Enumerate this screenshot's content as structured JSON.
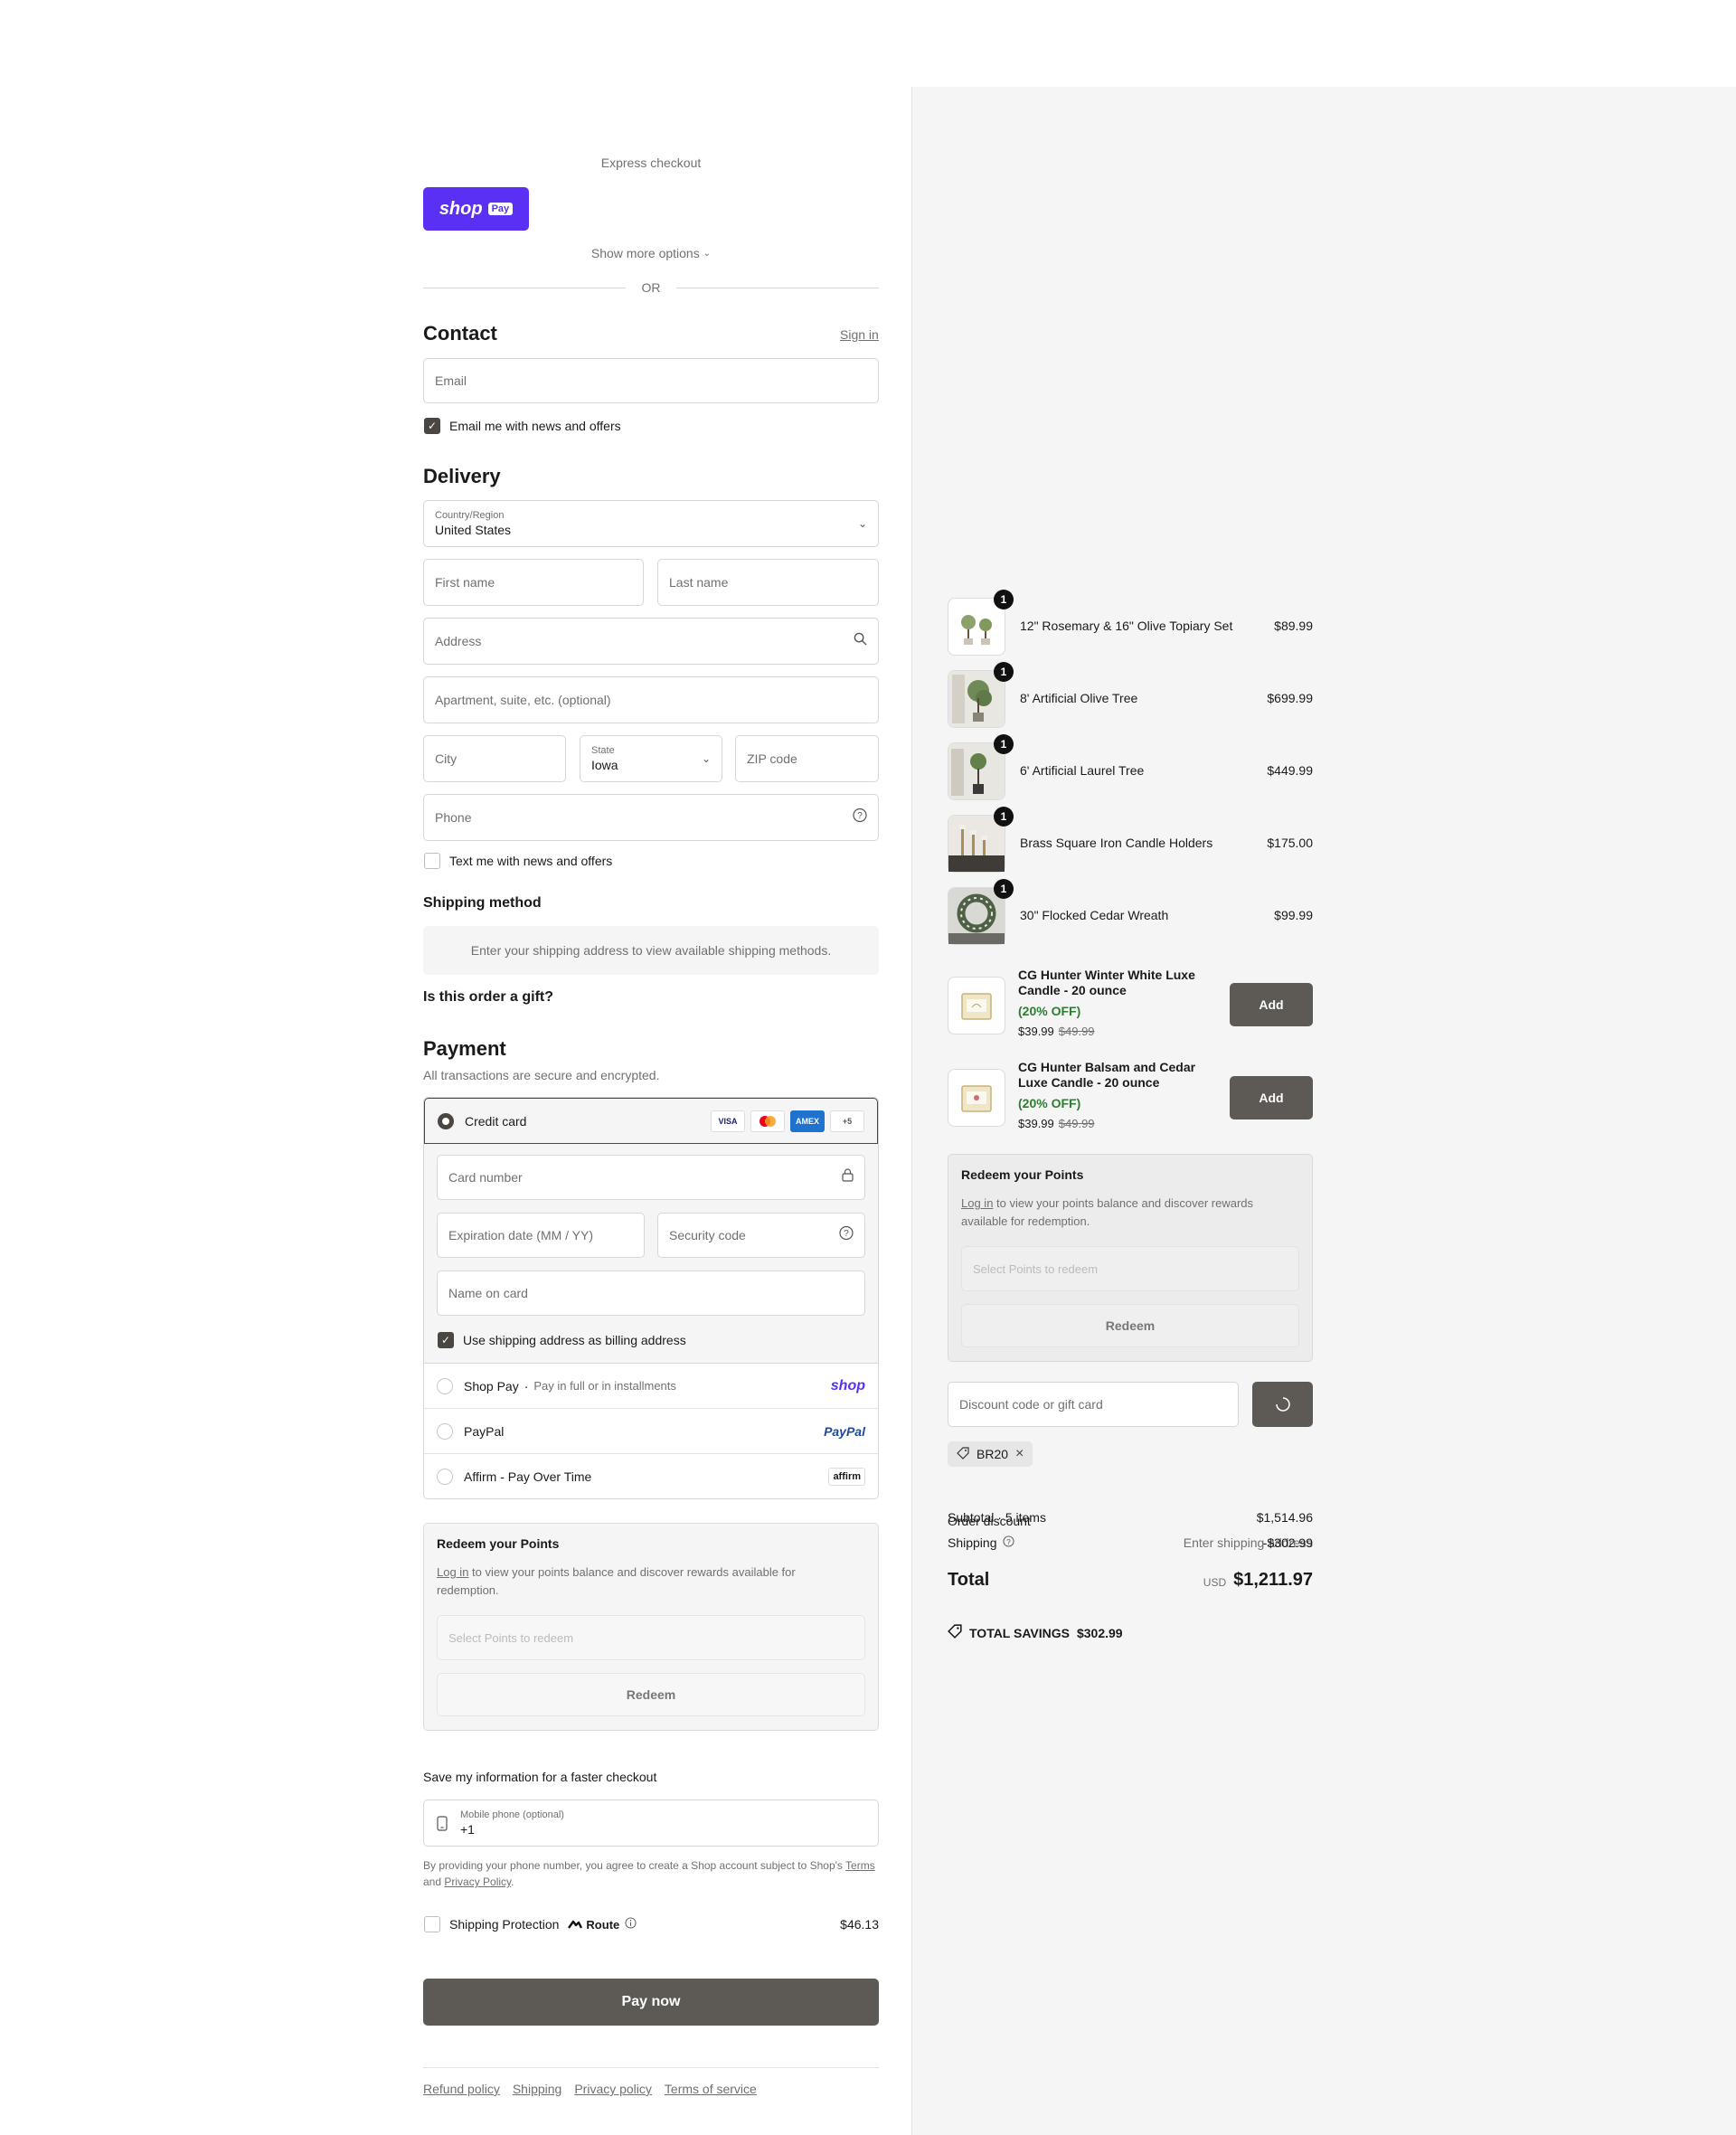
{
  "express": {
    "title": "Express checkout",
    "shop_pay": "shop",
    "shop_pay_tag": "Pay",
    "more_options": "Show more options",
    "or": "OR"
  },
  "contact": {
    "heading": "Contact",
    "sign_in": "Sign in",
    "email_placeholder": "Email",
    "news_label": "Email me with news and offers"
  },
  "delivery": {
    "heading": "Delivery",
    "country_label": "Country/Region",
    "country_value": "United States",
    "first_name": "First name",
    "last_name": "Last name",
    "address": "Address",
    "apartment": "Apartment, suite, etc. (optional)",
    "city": "City",
    "state_label": "State",
    "state_value": "Iowa",
    "zip": "ZIP code",
    "phone": "Phone",
    "text_label": "Text me with news and offers"
  },
  "shipping_method": {
    "heading": "Shipping method",
    "notice": "Enter your shipping address to view available shipping methods."
  },
  "gift": {
    "heading": "Is this order a gift?"
  },
  "payment": {
    "heading": "Payment",
    "subtitle": "All transactions are secure and encrypted.",
    "credit_card": "Credit card",
    "card_brands": [
      "VISA",
      "MC",
      "AMEX",
      "+5"
    ],
    "card_number": "Card number",
    "expiration": "Expiration date (MM / YY)",
    "security_code": "Security code",
    "name_on_card": "Name on card",
    "use_shipping": "Use shipping address as billing address",
    "shop_pay_label": "Shop Pay",
    "shop_pay_dot": "·",
    "shop_pay_sub": "Pay in full or in installments",
    "shop_pay_logo": "shop",
    "paypal_label": "PayPal",
    "paypal_logo": "PayPal",
    "affirm_label": "Affirm - Pay Over Time",
    "affirm_logo": "affirm"
  },
  "points_left": {
    "heading": "Redeem your Points",
    "login": "Log in",
    "text": " to view your points balance and discover rewards available for redemption.",
    "select": "Select Points to redeem",
    "button": "Redeem"
  },
  "save_info": {
    "heading": "Save my information for a faster checkout",
    "phone_label": "Mobile phone (optional)",
    "phone_value": "+1",
    "legal_1": "By providing your phone number, you agree to create a Shop account subject to Shop's ",
    "terms": "Terms",
    "legal_and": " and ",
    "privacy": "Privacy Policy",
    "legal_end": "."
  },
  "protection": {
    "label": "Shipping Protection",
    "brand": "Route",
    "price": "$46.13"
  },
  "pay_now": "Pay now",
  "footer": {
    "links": [
      "Refund policy",
      "Shipping",
      "Privacy policy",
      "Terms of service"
    ]
  },
  "cart": {
    "items": [
      {
        "qty": "1",
        "name": "12\" Rosemary & 16\" Olive Topiary Set",
        "price": "$89.99"
      },
      {
        "qty": "1",
        "name": "8' Artificial Olive Tree",
        "price": "$699.99"
      },
      {
        "qty": "1",
        "name": "6' Artificial Laurel Tree",
        "price": "$449.99"
      },
      {
        "qty": "1",
        "name": "Brass Square Iron Candle Holders",
        "price": "$175.00"
      },
      {
        "qty": "1",
        "name": "30\" Flocked Cedar Wreath",
        "price": "$99.99"
      }
    ],
    "upsells": [
      {
        "name": "CG Hunter Winter White Luxe Candle - 20 ounce",
        "off": "(20% OFF)",
        "price": "$39.99",
        "compare": "$49.99",
        "button": "Add"
      },
      {
        "name": "CG Hunter Balsam and Cedar Luxe Candle - 20 ounce",
        "off": "(20% OFF)",
        "price": "$39.99",
        "compare": "$49.99",
        "button": "Add"
      }
    ],
    "points": {
      "heading": "Redeem your Points",
      "login": "Log in",
      "text": " to view your points balance and discover rewards available for redemption.",
      "select": "Select Points to redeem",
      "button": "Redeem"
    },
    "discount_placeholder": "Discount code or gift card",
    "discount_tag": "BR20",
    "summary": {
      "subtotal_label": "Subtotal · 5 items",
      "subtotal_value": "$1,514.96",
      "order_discount_label": "Order discount",
      "shipping_label": "Shipping",
      "shipping_value": "Enter shipping address",
      "discount_value": "-$302.99",
      "total_label": "Total",
      "currency": "USD",
      "total_value": "$1,211.97",
      "savings_label": "TOTAL SAVINGS",
      "savings_value": "$302.99"
    }
  },
  "colors": {
    "shop_pay": "#5a31f4",
    "dark_button": "#5d5954",
    "green": "#2e7d32",
    "sidebar_bg": "#f5f5f5"
  }
}
